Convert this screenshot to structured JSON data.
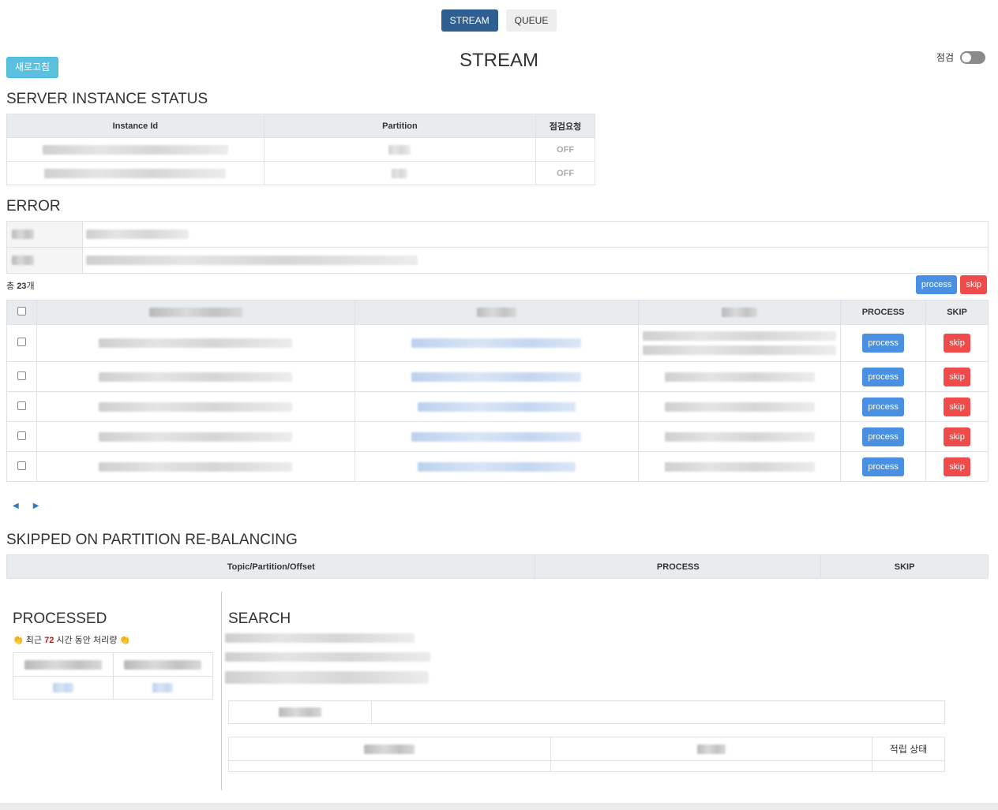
{
  "tabs": [
    {
      "label": "STREAM",
      "active": true
    },
    {
      "label": "QUEUE",
      "active": false
    }
  ],
  "header": {
    "refresh_label": "새로고침",
    "title": "STREAM",
    "maintenance_label": "점검",
    "maintenance_on": false
  },
  "server_status": {
    "title": "SERVER INSTANCE STATUS",
    "columns": [
      "Instance Id",
      "Partition",
      "점검요청"
    ],
    "rows": [
      {
        "maintenance": "OFF"
      },
      {
        "maintenance": "OFF"
      }
    ]
  },
  "error": {
    "title": "ERROR",
    "total_prefix": "총",
    "total_count": "23",
    "total_suffix": "개",
    "bulk_process_label": "process",
    "bulk_skip_label": "skip",
    "columns": {
      "process": "PROCESS",
      "skip": "SKIP"
    },
    "row_process_label": "process",
    "row_skip_label": "skip",
    "pager": {
      "prev": "◀",
      "next": "▶"
    }
  },
  "skipped": {
    "title": "SKIPPED ON PARTITION RE-BALANCING",
    "columns": [
      "Topic/Partition/Offset",
      "PROCESS",
      "SKIP"
    ]
  },
  "processed": {
    "title": "PROCESSED",
    "subtitle_prefix": "최근",
    "hours": "72",
    "subtitle_suffix": "시간 동안 처리량"
  },
  "search": {
    "title": "SEARCH",
    "result_status_header": "적립 상태"
  },
  "colors": {
    "primary": "#2f5f90",
    "info": "#5bc0de",
    "process": "#4a90e2",
    "skip": "#ef4b4b"
  }
}
